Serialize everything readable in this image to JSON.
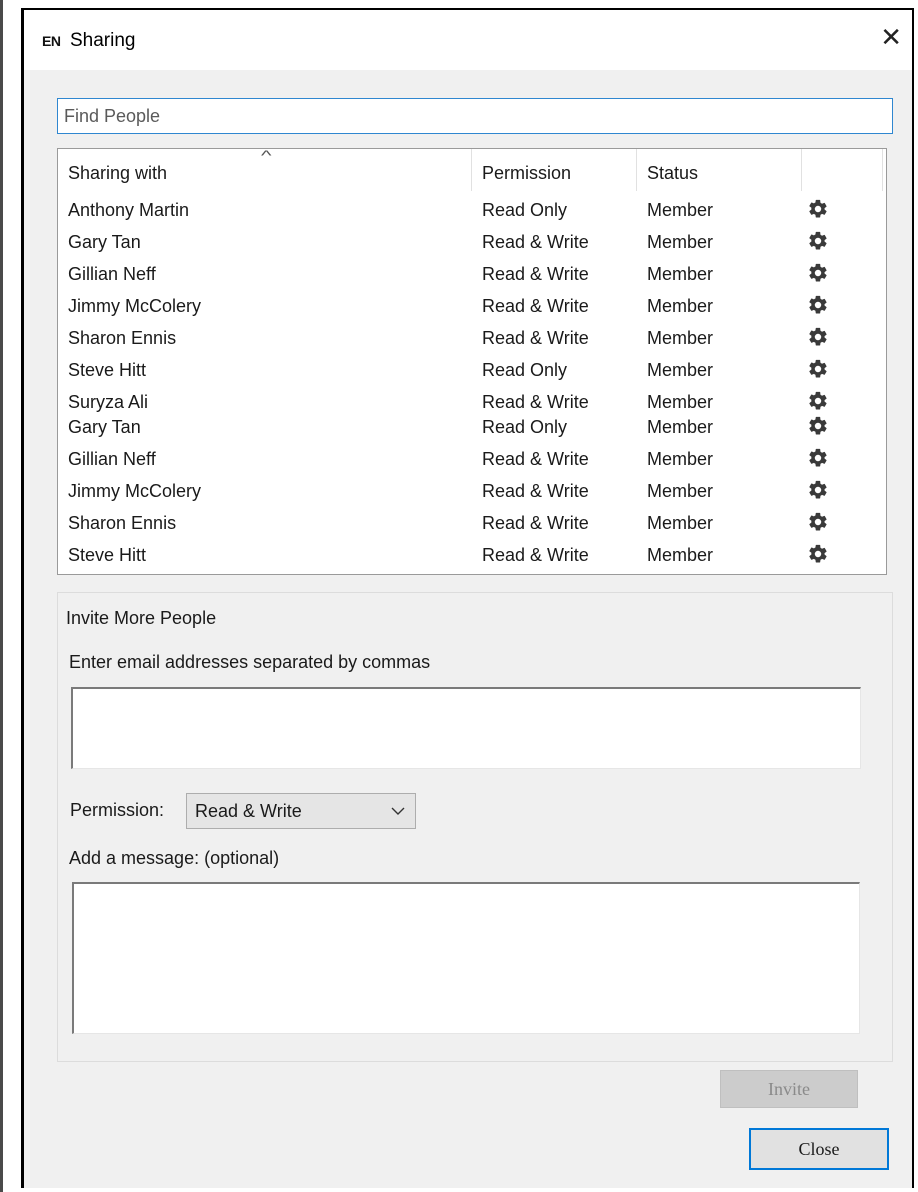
{
  "window": {
    "title": "Sharing",
    "app_icon": "EN"
  },
  "search": {
    "placeholder": "Find People"
  },
  "table": {
    "headers": [
      "Sharing with",
      "Permission",
      "Status"
    ],
    "rows": [
      {
        "name": "Anthony Martin",
        "permission": "Read Only",
        "status": "Member"
      },
      {
        "name": "Gary Tan",
        "permission": "Read & Write",
        "status": "Member"
      },
      {
        "name": "Gillian Neff",
        "permission": "Read & Write",
        "status": "Member"
      },
      {
        "name": "Jimmy McColery",
        "permission": "Read & Write",
        "status": "Member"
      },
      {
        "name": "Sharon Ennis",
        "permission": "Read & Write",
        "status": "Member"
      },
      {
        "name": "Steve Hitt",
        "permission": "Read Only",
        "status": "Member"
      },
      {
        "name": "Suryza Ali",
        "permission": "Read & Write",
        "status": "Member"
      },
      {
        "name": "Gary Tan",
        "permission": "Read Only",
        "status": "Member"
      },
      {
        "name": "Gillian Neff",
        "permission": "Read & Write",
        "status": "Member"
      },
      {
        "name": "Jimmy McColery",
        "permission": "Read & Write",
        "status": "Member"
      },
      {
        "name": "Sharon Ennis",
        "permission": "Read & Write",
        "status": "Member"
      },
      {
        "name": "Steve Hitt",
        "permission": "Read & Write",
        "status": "Member"
      }
    ],
    "row_icon": "gear-icon"
  },
  "invite": {
    "legend": "Invite More People",
    "email_label": "Enter email addresses separated by commas",
    "permission_label": "Permission:",
    "permission_value": "Read & Write",
    "message_label": "Add a message: (optional)",
    "invite_button": "Invite"
  },
  "footer": {
    "close_button": "Close"
  },
  "colors": {
    "accent": "#0078d7",
    "focus_border": "#2f87d0",
    "dialog_bg": "#f0f0f0"
  }
}
